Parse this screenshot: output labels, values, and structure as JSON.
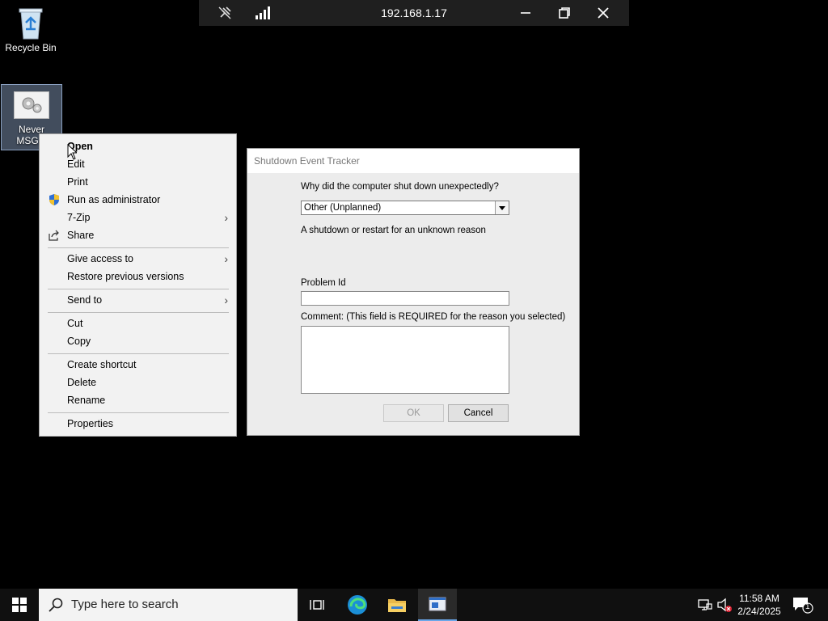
{
  "desktop": {
    "recycle_bin_label": "Recycle Bin",
    "file_label_line1": "Never",
    "file_label_line2": "MSG.b"
  },
  "remote_bar": {
    "host": "192.168.1.17"
  },
  "context_menu": {
    "open": "Open",
    "edit": "Edit",
    "print": "Print",
    "run_as_admin": "Run as administrator",
    "seven_zip": "7-Zip",
    "share": "Share",
    "give_access": "Give access to",
    "restore_versions": "Restore previous versions",
    "send_to": "Send to",
    "cut": "Cut",
    "copy": "Copy",
    "create_shortcut": "Create shortcut",
    "delete": "Delete",
    "rename": "Rename",
    "properties": "Properties"
  },
  "dialog": {
    "title": "Shutdown Event Tracker",
    "question": "Why did the computer shut down unexpectedly?",
    "selected_reason": "Other (Unplanned)",
    "reason_description": "A shutdown or restart for an unknown reason",
    "problem_id_label": "Problem Id",
    "problem_id_value": "",
    "comment_label": "Comment: (This field is REQUIRED for the reason you selected)",
    "comment_value": "",
    "ok_label": "OK",
    "cancel_label": "Cancel"
  },
  "taskbar": {
    "search_placeholder": "Type here to search",
    "time": "11:58 AM",
    "date": "2/24/2025",
    "notification_count": "1"
  },
  "colors": {
    "desktop_bg": "#000000",
    "menu_bg": "#f2f2f2",
    "dialog_bg": "#ececec",
    "taskbar_bg": "#101010",
    "accent": "#6aa6e8"
  }
}
